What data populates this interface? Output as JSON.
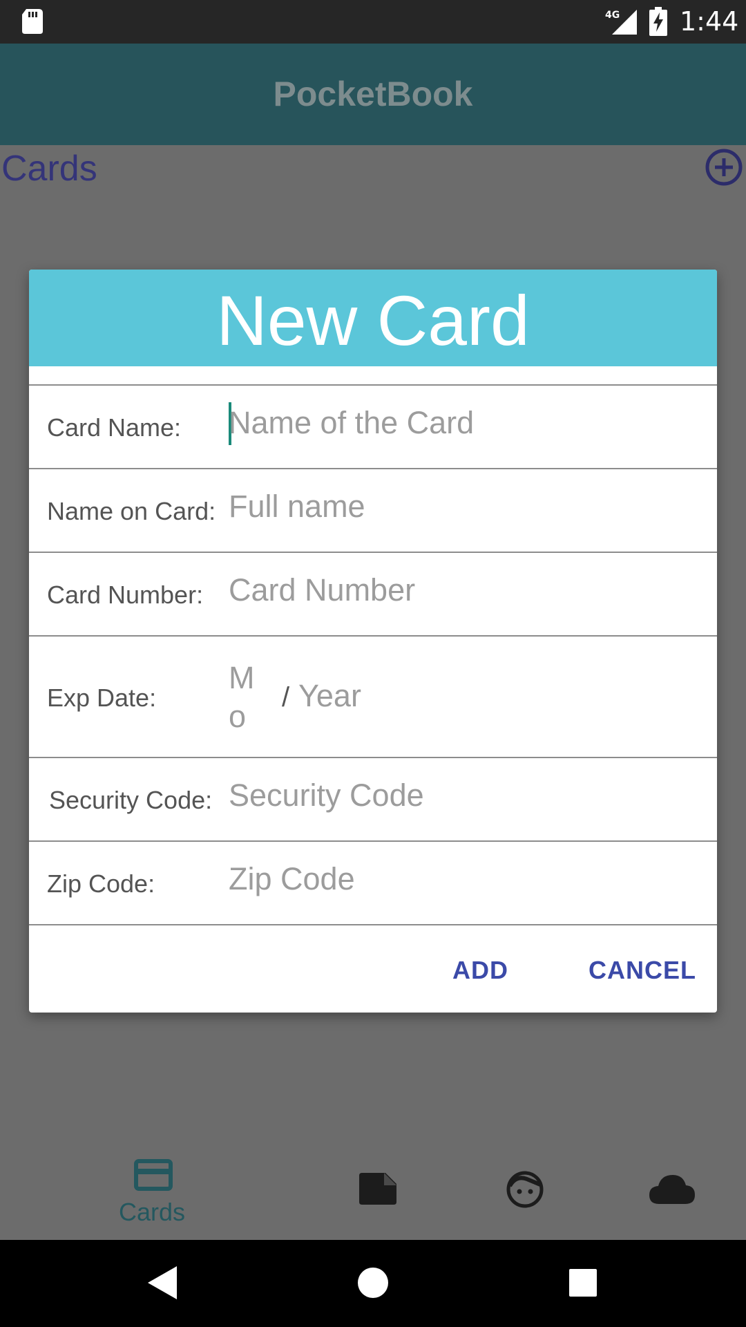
{
  "status_bar": {
    "network": "4G",
    "time": "1:44",
    "icons": [
      "sd-card-icon",
      "signal-icon",
      "battery-charging-icon"
    ]
  },
  "app": {
    "title": "PocketBook",
    "section_title": "Cards",
    "add_icon": "add-circle-icon"
  },
  "dialog": {
    "title": "New Card",
    "fields": [
      {
        "label": "Card Name:",
        "placeholder": "Name of the Card"
      },
      {
        "label": "Name on Card:",
        "placeholder": "Full name"
      },
      {
        "label": "Card Number:",
        "placeholder": "Card Number"
      },
      {
        "label": "Exp Date:",
        "month_placeholder": "Mo",
        "separator": "/",
        "year_placeholder": "Year"
      },
      {
        "label": "Security Code:",
        "placeholder": "Security Code"
      },
      {
        "label": "Zip Code:",
        "placeholder": "Zip Code"
      }
    ],
    "add_label": "ADD",
    "cancel_label": "CANCEL"
  },
  "bottom_nav": {
    "items": [
      {
        "icon": "credit-card-icon",
        "label": "Cards",
        "active": true
      },
      {
        "icon": "note-icon"
      },
      {
        "icon": "face-icon"
      },
      {
        "icon": "cloud-icon"
      }
    ]
  },
  "system_nav": [
    "back-icon",
    "home-icon",
    "recents-icon"
  ],
  "colors": {
    "dialog_header": "#5bc6d9",
    "button_text": "#3b4aa8",
    "app_bar_dimmed": "#27545b",
    "scrim_background": "#6c6c6c"
  }
}
